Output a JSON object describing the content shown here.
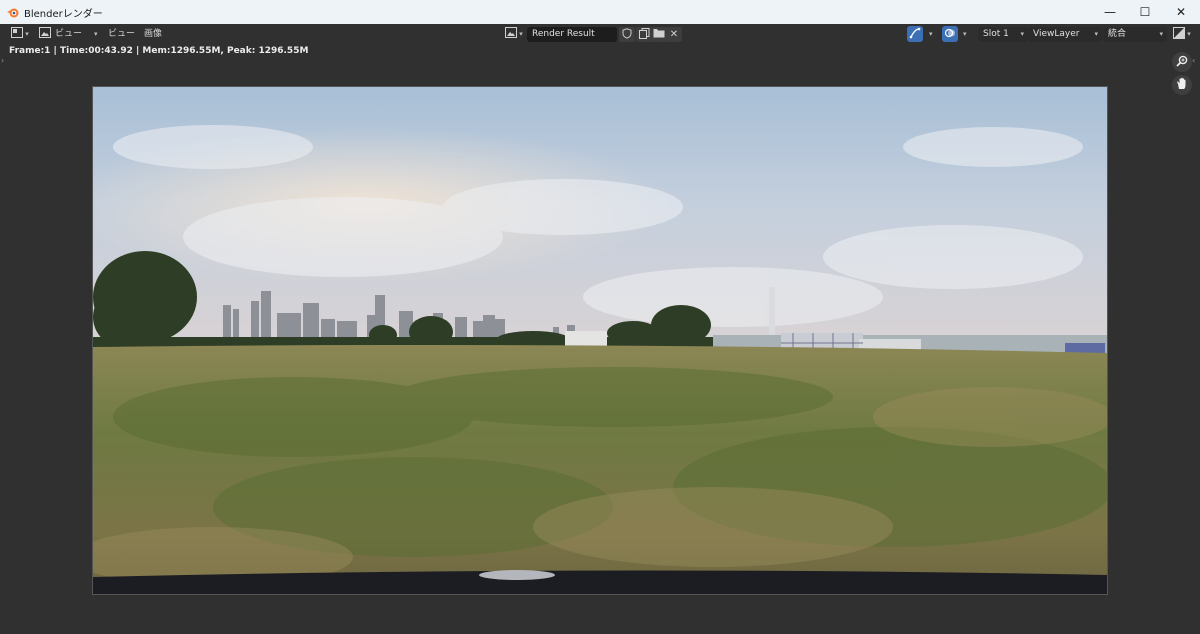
{
  "window": {
    "title": "Blenderレンダー",
    "controls": {
      "minimize": "—",
      "maximize": "☐",
      "close": "✕"
    }
  },
  "header": {
    "menus": [
      "ビュー",
      "ビュー",
      "画像"
    ],
    "image_name": "Render Result",
    "slot": "Slot 1",
    "view_layer": "ViewLayer",
    "pass": "統合"
  },
  "info": {
    "text": "Frame:1 | Time:00:43.92 | Mem:1296.55M, Peak: 1296.55M"
  },
  "icons": {
    "app": "blender-logo-icon",
    "editor_type": "image-editor-icon",
    "image_browse": "image-browse-icon",
    "fake_user": "shield-icon",
    "duplicate": "duplicate-icon",
    "open": "folder-icon",
    "unlink": "close-icon",
    "gizmo": "gizmo-icon",
    "overlay": "overlay-icon",
    "display_channels": "display-channels-icon",
    "zoom": "zoom-icon",
    "pan": "hand-icon"
  },
  "colors": {
    "background": "#303030",
    "titlebar": "#eef3f7",
    "accent": "#3d6fb5"
  }
}
